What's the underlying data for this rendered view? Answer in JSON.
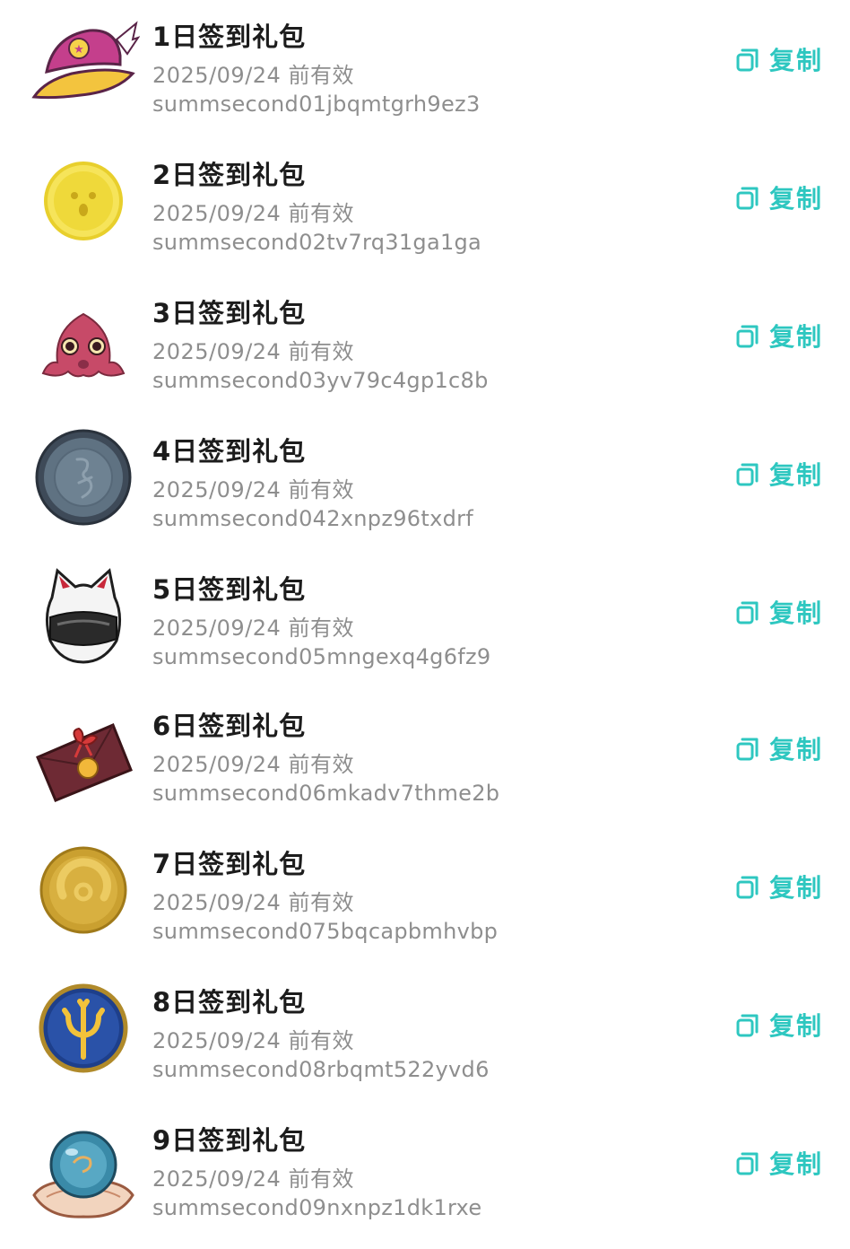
{
  "accent_color": "#2ec7c0",
  "items": [
    {
      "title": "1日签到礼包",
      "expiry": "2025/09/24 前有效",
      "code": "summsecond01jbqmtgrh9ez3",
      "copy_label": "复制",
      "icon": "winged-cap-icon"
    },
    {
      "title": "2日签到礼包",
      "expiry": "2025/09/24 前有效",
      "code": "summsecond02tv7rq31ga1ga",
      "copy_label": "复制",
      "icon": "yellow-face-coin-icon"
    },
    {
      "title": "3日签到礼包",
      "expiry": "2025/09/24 前有效",
      "code": "summsecond03yv79c4gp1c8b",
      "copy_label": "复制",
      "icon": "octopus-icon"
    },
    {
      "title": "4日签到礼包",
      "expiry": "2025/09/24 前有效",
      "code": "summsecond042xnpz96txdrf",
      "copy_label": "复制",
      "icon": "gray-rune-coin-icon"
    },
    {
      "title": "5日签到礼包",
      "expiry": "2025/09/24 前有效",
      "code": "summsecond05mngexq4g6fz9",
      "copy_label": "复制",
      "icon": "cat-helmet-icon"
    },
    {
      "title": "6日签到礼包",
      "expiry": "2025/09/24 前有效",
      "code": "summsecond06mkadv7thme2b",
      "copy_label": "复制",
      "icon": "envelope-bow-icon"
    },
    {
      "title": "7日签到礼包",
      "expiry": "2025/09/24 前有效",
      "code": "summsecond075bqcapbmhvbp",
      "copy_label": "复制",
      "icon": "gold-ring-coin-icon"
    },
    {
      "title": "8日签到礼包",
      "expiry": "2025/09/24 前有效",
      "code": "summsecond08rbqmt522yvd6",
      "copy_label": "复制",
      "icon": "trident-coin-icon"
    },
    {
      "title": "9日签到礼包",
      "expiry": "2025/09/24 前有效",
      "code": "summsecond09nxnpz1dk1rxe",
      "copy_label": "复制",
      "icon": "crystal-ball-icon"
    }
  ]
}
